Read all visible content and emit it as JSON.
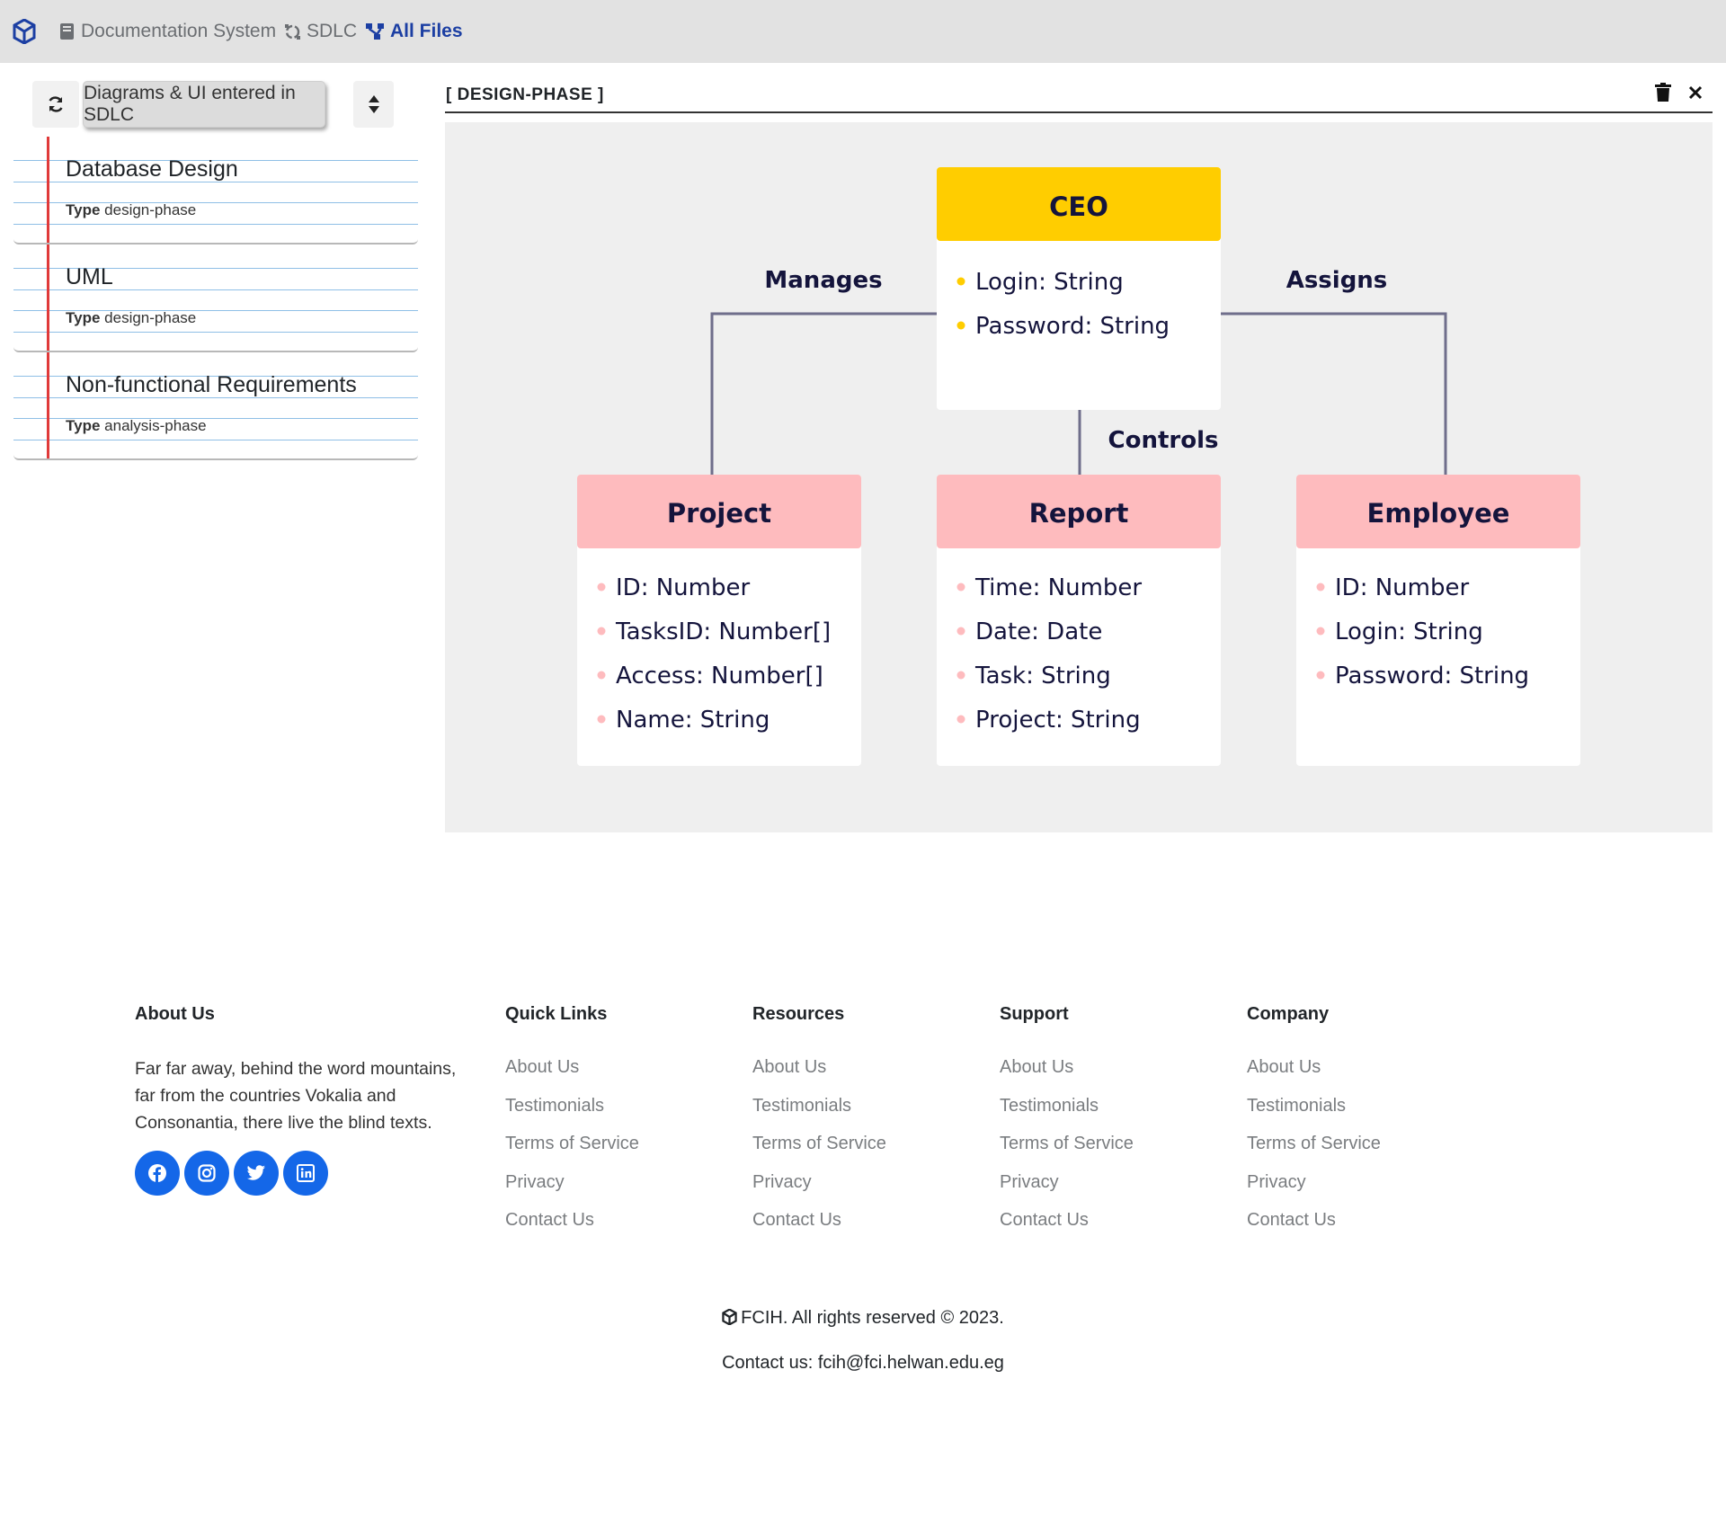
{
  "nav": {
    "logo_icon": "cube-logo-icon",
    "items": [
      {
        "label": "Documentation System",
        "icon": "book-icon",
        "active": false
      },
      {
        "label": "SDLC",
        "icon": "cycle-icon",
        "active": false
      },
      {
        "label": "All Files",
        "icon": "sitemap-icon",
        "active": true
      }
    ]
  },
  "sidebar": {
    "refresh_icon": "refresh-icon",
    "filter_label": "Diagrams & UI entered in SDLC",
    "sort_icon": "sort-icon",
    "items": [
      {
        "title": "Database Design",
        "type_label": "Type",
        "type_value": "design-phase"
      },
      {
        "title": "UML",
        "type_label": "Type",
        "type_value": "design-phase"
      },
      {
        "title": "Non-functional Requirements",
        "type_label": "Type",
        "type_value": "analysis-phase"
      }
    ]
  },
  "panel": {
    "title": "[ DESIGN-PHASE ]",
    "trash_icon": "trash-icon",
    "close_icon": "close-icon",
    "diagram": {
      "ceo": {
        "title": "CEO",
        "fields": [
          "Login: String",
          "Password: String"
        ]
      },
      "relations": {
        "left": "Manages",
        "right": "Assigns",
        "middle": "Controls"
      },
      "project": {
        "title": "Project",
        "fields": [
          "ID: Number",
          "TasksID: Number[]",
          "Access: Number[]",
          "Name: String"
        ]
      },
      "report": {
        "title": "Report",
        "fields": [
          "Time: Number",
          "Date: Date",
          "Task: String",
          "Project: String"
        ]
      },
      "employee": {
        "title": "Employee",
        "fields": [
          "ID: Number",
          "Login: String",
          "Password: String"
        ]
      },
      "colors": {
        "ceo_header": "#FFCD00",
        "entity_header": "#FEBBBE",
        "bullet_ceo": "#FFCD00",
        "bullet_entity": "#FEBBBE",
        "text": "#14143C",
        "line": "#6F6E8B"
      }
    }
  },
  "footer": {
    "about": {
      "heading": "About Us",
      "text": "Far far away, behind the word mountains, far from the countries Vokalia and Consonantia, there live the blind texts.",
      "socials": [
        "facebook-icon",
        "instagram-icon",
        "twitter-icon",
        "linkedin-icon"
      ]
    },
    "columns": [
      {
        "heading": "Quick Links",
        "links": [
          "About Us",
          "Testimonials",
          "Terms of Service",
          "Privacy",
          "Contact Us"
        ]
      },
      {
        "heading": "Resources",
        "links": [
          "About Us",
          "Testimonials",
          "Terms of Service",
          "Privacy",
          "Contact Us"
        ]
      },
      {
        "heading": "Support",
        "links": [
          "About Us",
          "Testimonials",
          "Terms of Service",
          "Privacy",
          "Contact Us"
        ]
      },
      {
        "heading": "Company",
        "links": [
          "About Us",
          "Testimonials",
          "Terms of Service",
          "Privacy",
          "Contact Us"
        ]
      }
    ],
    "copyright": "FCIH. All rights reserved © 2023.",
    "contact": "Contact us: fcih@fci.helwan.edu.eg"
  }
}
